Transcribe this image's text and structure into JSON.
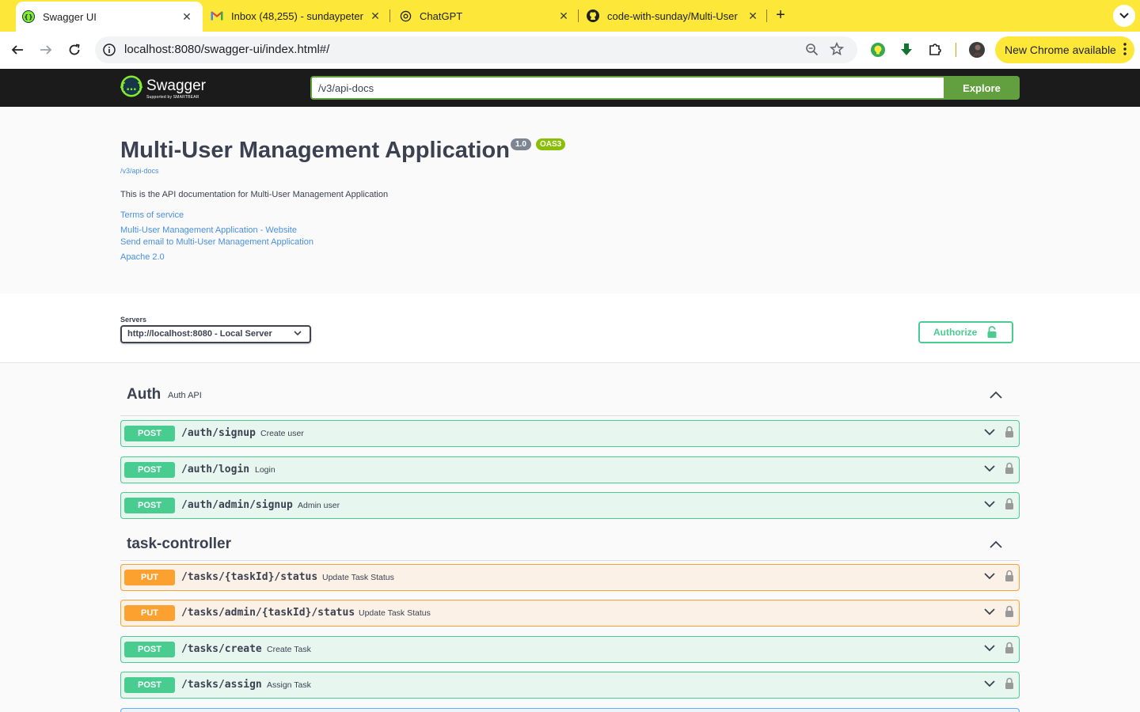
{
  "browser": {
    "tabs": [
      {
        "title": "Swagger UI",
        "icon": "swagger-favicon"
      },
      {
        "title": "Inbox (48,255) - sundaypeter",
        "icon": "gmail-icon"
      },
      {
        "title": "ChatGPT",
        "icon": "chatgpt-icon"
      },
      {
        "title": "code-with-sunday/Multi-User",
        "icon": "github-icon"
      }
    ],
    "url": "localhost:8080/swagger-ui/index.html#/",
    "update_button": "New Chrome available"
  },
  "swagger": {
    "logo_text": "Swagger",
    "logo_sub": "Supported by SMARTBEAR",
    "explore_input": "/v3/api-docs",
    "explore_button": "Explore"
  },
  "info": {
    "title": "Multi-User Management Application",
    "version": "1.0",
    "oas": "OAS3",
    "spec_url": "/v3/api-docs",
    "description": "This is the API documentation for Multi-User Management Application",
    "links": {
      "terms": "Terms of service",
      "website": "Multi-User Management Application - Website",
      "email": "Send email to Multi-User Management Application",
      "license": "Apache 2.0"
    }
  },
  "servers": {
    "label": "Servers",
    "selected": "http://localhost:8080 - Local Server",
    "authorize_button": "Authorize"
  },
  "sections": [
    {
      "name": "Auth",
      "description": "Auth API",
      "operations": [
        {
          "method": "POST",
          "path": "/auth/signup",
          "summary": "Create user"
        },
        {
          "method": "POST",
          "path": "/auth/login",
          "summary": "Login"
        },
        {
          "method": "POST",
          "path": "/auth/admin/signup",
          "summary": "Admin user"
        }
      ]
    },
    {
      "name": "task-controller",
      "description": "",
      "operations": [
        {
          "method": "PUT",
          "path": "/tasks/{taskId}/status",
          "summary": "Update Task Status"
        },
        {
          "method": "PUT",
          "path": "/tasks/admin/{taskId}/status",
          "summary": "Update Task Status"
        },
        {
          "method": "POST",
          "path": "/tasks/create",
          "summary": "Create Task"
        },
        {
          "method": "POST",
          "path": "/tasks/assign",
          "summary": "Assign Task"
        }
      ]
    }
  ],
  "colors": {
    "chrome_accent": "#fde83a",
    "post": "#49cc90",
    "put": "#fca130",
    "link": "#4990e2",
    "swagger_green": "#62a03f"
  }
}
